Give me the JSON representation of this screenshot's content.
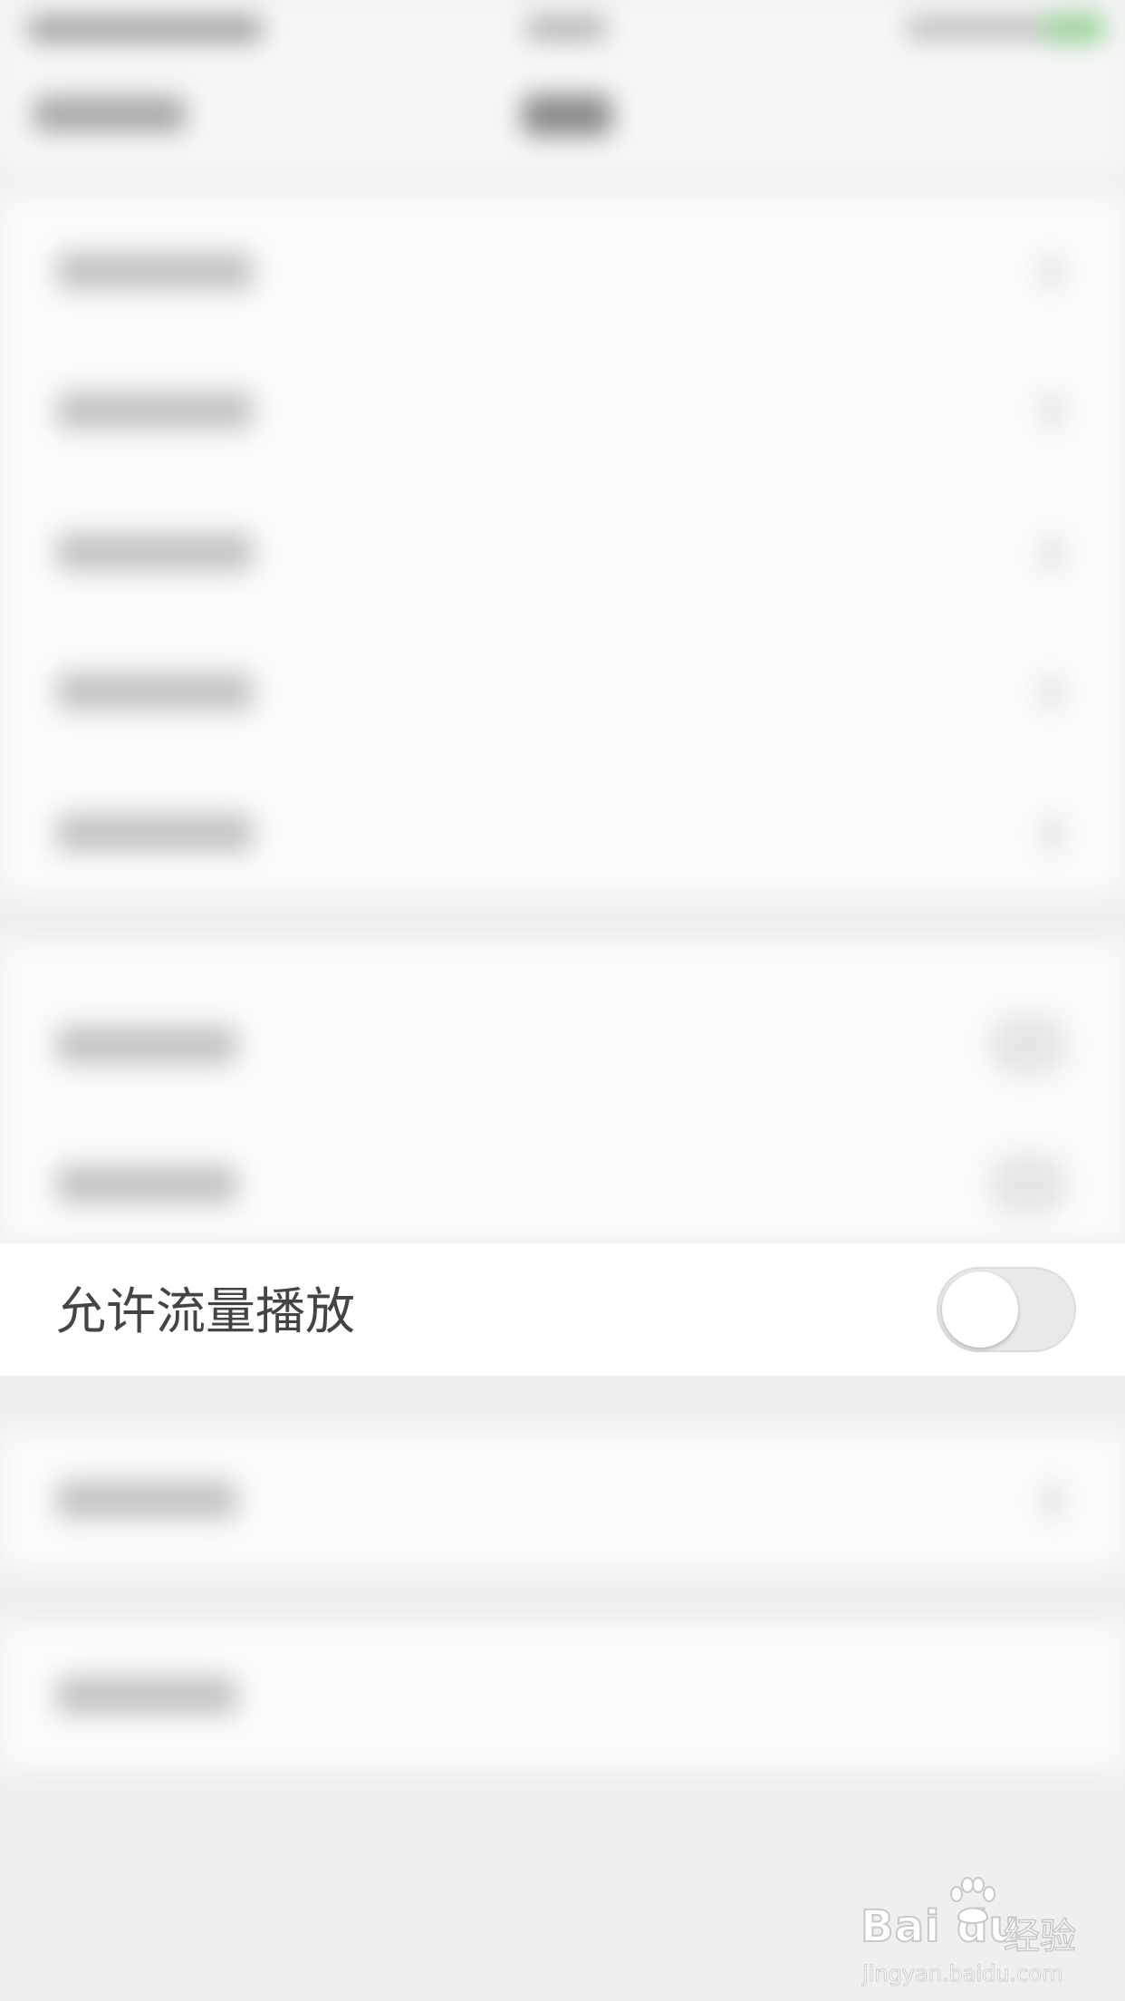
{
  "settings": {
    "allow_data_playback_label": "允许流量播放",
    "allow_data_playback_enabled": false
  },
  "watermark": {
    "logo": "Bai du",
    "brand_cn": "经验",
    "url": "jingyan.baidu.com"
  },
  "colors": {
    "page_background": "#efefef",
    "row_background": "#ffffff",
    "label_text": "#444444",
    "toggle_track_off": "#e9e9e9",
    "toggle_knob": "#ffffff",
    "battery_accent": "#9ad19a"
  }
}
